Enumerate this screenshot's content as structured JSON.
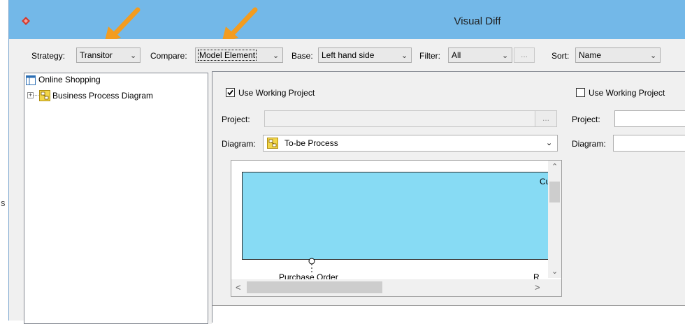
{
  "left_strip_text": "s",
  "window": {
    "title": "Visual Diff"
  },
  "toolbar": {
    "strategy_label": "Strategy:",
    "strategy_value": "Transitor",
    "compare_label": "Compare:",
    "compare_value": "Model Element",
    "base_label": "Base:",
    "base_value": "Left hand side",
    "filter_label": "Filter:",
    "filter_value": "All",
    "dots_label": "...",
    "sort_label": "Sort:",
    "sort_value": "Name"
  },
  "tree": {
    "root_label": "Online Shopping",
    "child_label": "Business Process Diagram"
  },
  "left_pane": {
    "use_working_project_label": "Use Working Project",
    "use_working_project_checked": true,
    "project_label": "Project:",
    "project_value": "",
    "project_browse_label": "...",
    "diagram_label": "Diagram:",
    "diagram_value": "To-be Process",
    "canvas": {
      "pool_text": "Cu",
      "bottom_label": "Purchase Order",
      "bottom_right_label": "R"
    }
  },
  "right_pane": {
    "use_working_project_label": "Use Working Project",
    "use_working_project_checked": false,
    "project_label": "Project:",
    "diagram_label": "Diagram:"
  },
  "colors": {
    "titlebar": "#73b8e8",
    "pool_fill": "#87dbf4",
    "annotation_arrow": "#f39c1f",
    "app_icon": "#d23b2f"
  },
  "icons": {
    "app": "app-diamond-icon",
    "tree_root": "diagram-window-icon",
    "tree_child": "business-process-diagram-icon",
    "annotation": "orange-arrow-icon"
  }
}
